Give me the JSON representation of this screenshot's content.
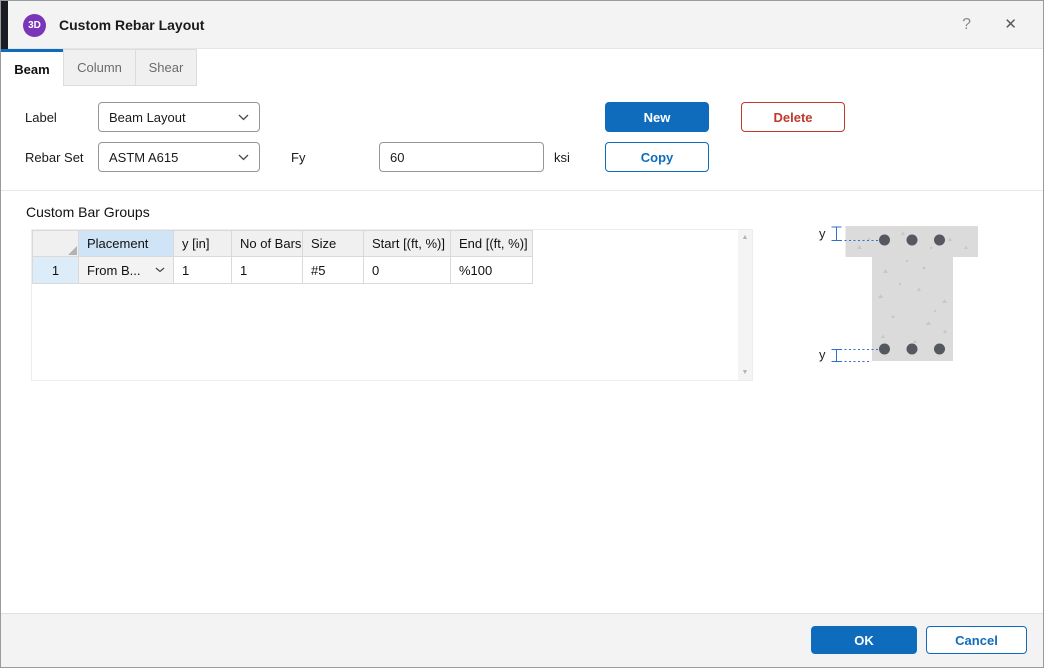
{
  "window": {
    "title": "Custom Rebar Layout",
    "icon_text": "3D",
    "help_icon": "?",
    "close_icon": "✕"
  },
  "tabs": {
    "beam": "Beam",
    "column": "Column",
    "shear": "Shear",
    "active_tab": "Beam"
  },
  "form": {
    "label_label": "Label",
    "label_value": "Beam Layout",
    "rebar_set_label": "Rebar Set",
    "rebar_set_value": "ASTM A615",
    "fy_label": "Fy",
    "fy_value": "60",
    "fy_unit": "ksi",
    "new_button": "New",
    "delete_button": "Delete",
    "copy_button": "Copy"
  },
  "section": {
    "title": "Custom Bar Groups"
  },
  "table": {
    "headers": {
      "placement": "Placement",
      "y": "y [in]",
      "bars": "No of Bars",
      "size": "Size",
      "start": "Start [(ft, %)]",
      "end": "End [(ft, %)]"
    },
    "row1": {
      "num": "1",
      "placement": "From B...",
      "y": "1",
      "bars": "1",
      "size": "#5",
      "start": "0",
      "end": "%100"
    }
  },
  "scrollbar": {
    "up_icon": "▲",
    "down_icon": "▼"
  },
  "diagram": {
    "dim_label_top": "y",
    "dim_label_bottom": "y",
    "top_bar_count": 3,
    "bottom_bar_count": 3,
    "shape": "T-beam cross-section"
  },
  "footer": {
    "ok": "OK",
    "cancel": "Cancel"
  },
  "colors": {
    "accent": "#0f6cbd",
    "danger": "#c0392b",
    "icon_purple": "#7a35b8",
    "dimension_blue": "#2e6fd0",
    "concrete_gray": "#dbdbdb",
    "rebar_gray": "#55585e"
  }
}
